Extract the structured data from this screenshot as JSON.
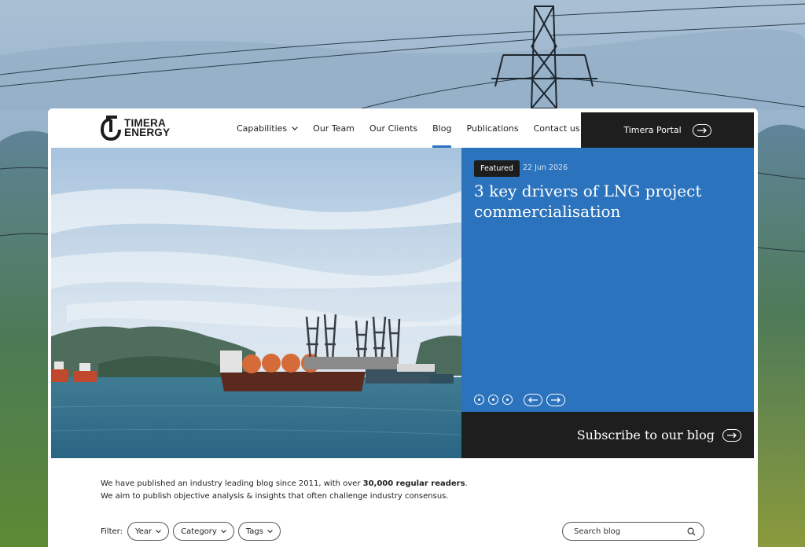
{
  "brand": {
    "name_line1": "TIMERA",
    "name_line2": "ENERGY"
  },
  "nav": {
    "items": [
      {
        "label": "Capabilities",
        "has_dropdown": true,
        "active": false
      },
      {
        "label": "Our Team",
        "has_dropdown": false,
        "active": false
      },
      {
        "label": "Our Clients",
        "has_dropdown": false,
        "active": false
      },
      {
        "label": "Blog",
        "has_dropdown": false,
        "active": true
      },
      {
        "label": "Publications",
        "has_dropdown": false,
        "active": false
      },
      {
        "label": "Contact us",
        "has_dropdown": false,
        "active": false
      }
    ],
    "search_icon": "search-icon",
    "portal_label": "Timera Portal"
  },
  "featured": {
    "badge": "Featured",
    "date": "22 Jun 2026",
    "title": "3 key drivers of LNG project commercialisation",
    "slide_count": 3
  },
  "subscribe": {
    "label": "Subscribe to our blog"
  },
  "intro": {
    "line1_prefix": "We have published an industry leading blog since 2011, with over ",
    "line1_bold": "30,000 regular readers",
    "line1_suffix": ".",
    "line2": "We aim to publish objective analysis & insights that often challenge industry consensus."
  },
  "filters": {
    "label": "Filter:",
    "options": [
      "Year",
      "Category",
      "Tags"
    ],
    "search_placeholder": "Search blog"
  },
  "colors": {
    "accent_blue": "#2c73bd",
    "dark": "#1e1e1e",
    "active_underline": "#2b72c0"
  }
}
